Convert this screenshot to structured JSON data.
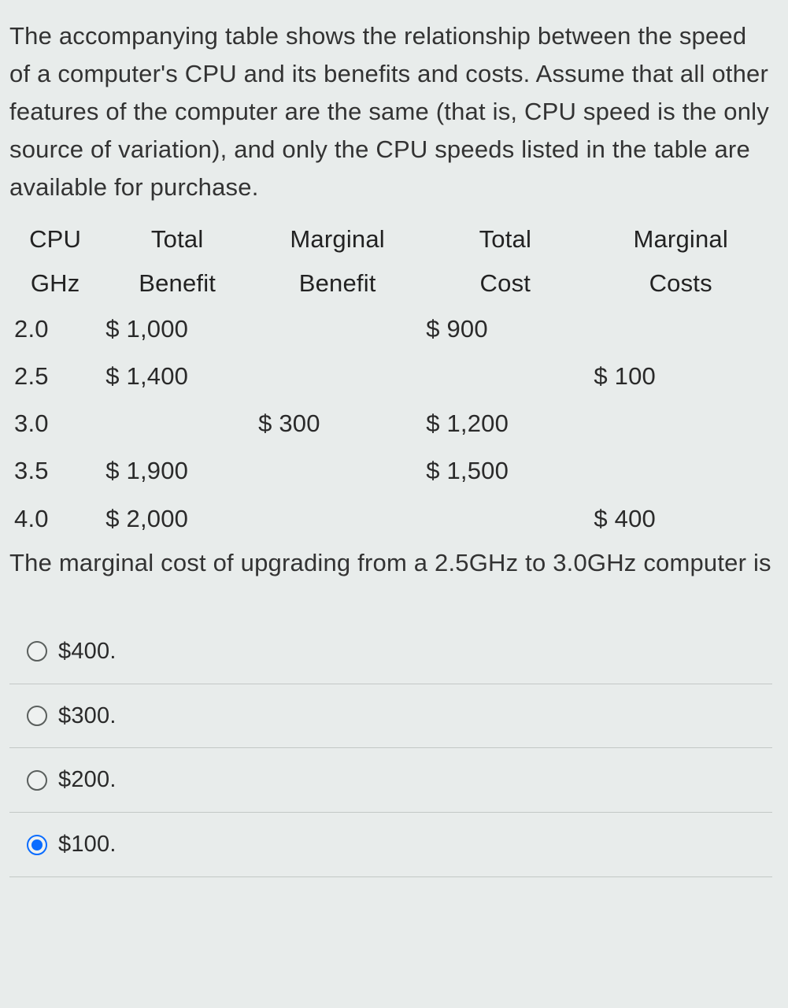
{
  "intro": "The accompanying table shows the relationship between the speed of a computer's CPU and its benefits and costs. Assume that all other features of the computer are the same (that is, CPU speed is the only source of variation), and only the CPU speeds listed in the table are available for purchase.",
  "table": {
    "headers": {
      "c0a": "CPU",
      "c0b": "GHz",
      "c1a": "Total",
      "c1b": "Benefit",
      "c2a": "Marginal",
      "c2b": "Benefit",
      "c3a": "Total",
      "c3b": "Cost",
      "c4a": "Marginal",
      "c4b": "Costs"
    },
    "rows": [
      {
        "ghz": "2.0",
        "tb": "$ 1,000",
        "mb": "",
        "tc": "$ 900",
        "mc": ""
      },
      {
        "ghz": "2.5",
        "tb": "$ 1,400",
        "mb": "",
        "tc": "",
        "mc": "$ 100"
      },
      {
        "ghz": "3.0",
        "tb": "",
        "mb": "$ 300",
        "tc": "$ 1,200",
        "mc": ""
      },
      {
        "ghz": "3.5",
        "tb": "$ 1,900",
        "mb": "",
        "tc": "$ 1,500",
        "mc": ""
      },
      {
        "ghz": "4.0",
        "tb": "$ 2,000",
        "mb": "",
        "tc": "",
        "mc": "$ 400"
      }
    ]
  },
  "question": "The marginal cost of upgrading from a 2.5GHz to 3.0GHz computer is",
  "options": [
    {
      "label": "$400.",
      "selected": false
    },
    {
      "label": "$300.",
      "selected": false
    },
    {
      "label": "$200.",
      "selected": false
    },
    {
      "label": "$100.",
      "selected": true
    }
  ],
  "chart_data": {
    "type": "table",
    "columns": [
      "CPU GHz",
      "Total Benefit",
      "Marginal Benefit",
      "Total Cost",
      "Marginal Costs"
    ],
    "rows": [
      [
        "2.0",
        "$ 1,000",
        "",
        "$ 900",
        ""
      ],
      [
        "2.5",
        "$ 1,400",
        "",
        "",
        "$ 100"
      ],
      [
        "3.0",
        "",
        "$ 300",
        "$ 1,200",
        ""
      ],
      [
        "3.5",
        "$ 1,900",
        "",
        "$ 1,500",
        ""
      ],
      [
        "4.0",
        "$ 2,000",
        "",
        "",
        "$ 400"
      ]
    ]
  }
}
